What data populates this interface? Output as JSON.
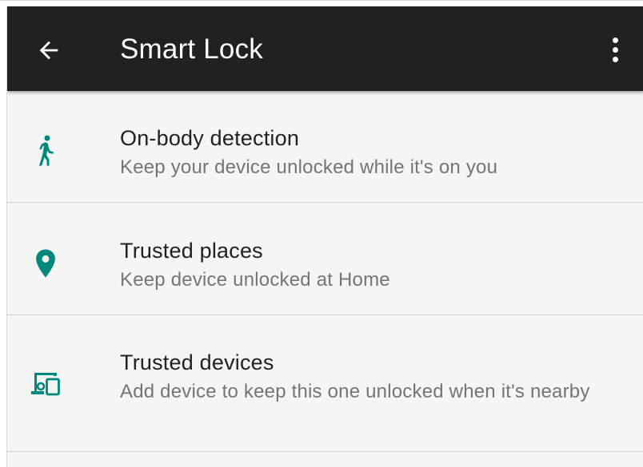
{
  "appbar": {
    "title": "Smart Lock",
    "back_icon": "arrow-left-icon",
    "overflow_icon": "more-vert-icon"
  },
  "colors": {
    "appbar_bg": "#212121",
    "accent": "#00897b",
    "background": "#f5f5f5"
  },
  "items": [
    {
      "title": "On-body detection",
      "subtitle": "Keep your device unlocked while it's on you",
      "icon": "walking-person-icon"
    },
    {
      "title": "Trusted places",
      "subtitle": "Keep device unlocked at Home",
      "icon": "location-pin-icon"
    },
    {
      "title": "Trusted devices",
      "subtitle": "Add device to keep this one unlocked when it's nearby",
      "icon": "devices-icon"
    }
  ]
}
